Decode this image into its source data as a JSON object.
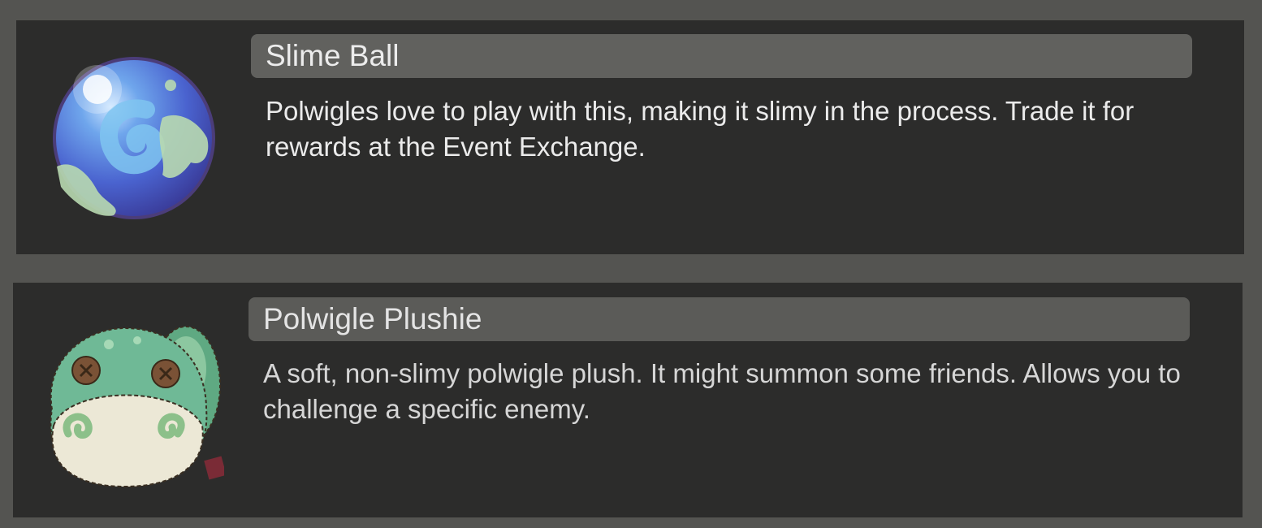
{
  "items": [
    {
      "name": "Slime Ball",
      "description": "Polwigles love to play with this, making it slimy in the process. Trade it for rewards at the Event Exchange.",
      "icon": "slime-ball-icon"
    },
    {
      "name": "Polwigle Plushie",
      "description": "A soft, non-slimy polwigle plush. It might summon some friends. Allows you to challenge a specific enemy.",
      "icon": "polwigle-plushie-icon"
    }
  ],
  "colors": {
    "background": "#545451",
    "card": "#2c2c2b",
    "title_bar": "#61615e",
    "text": "#ebebeb"
  }
}
